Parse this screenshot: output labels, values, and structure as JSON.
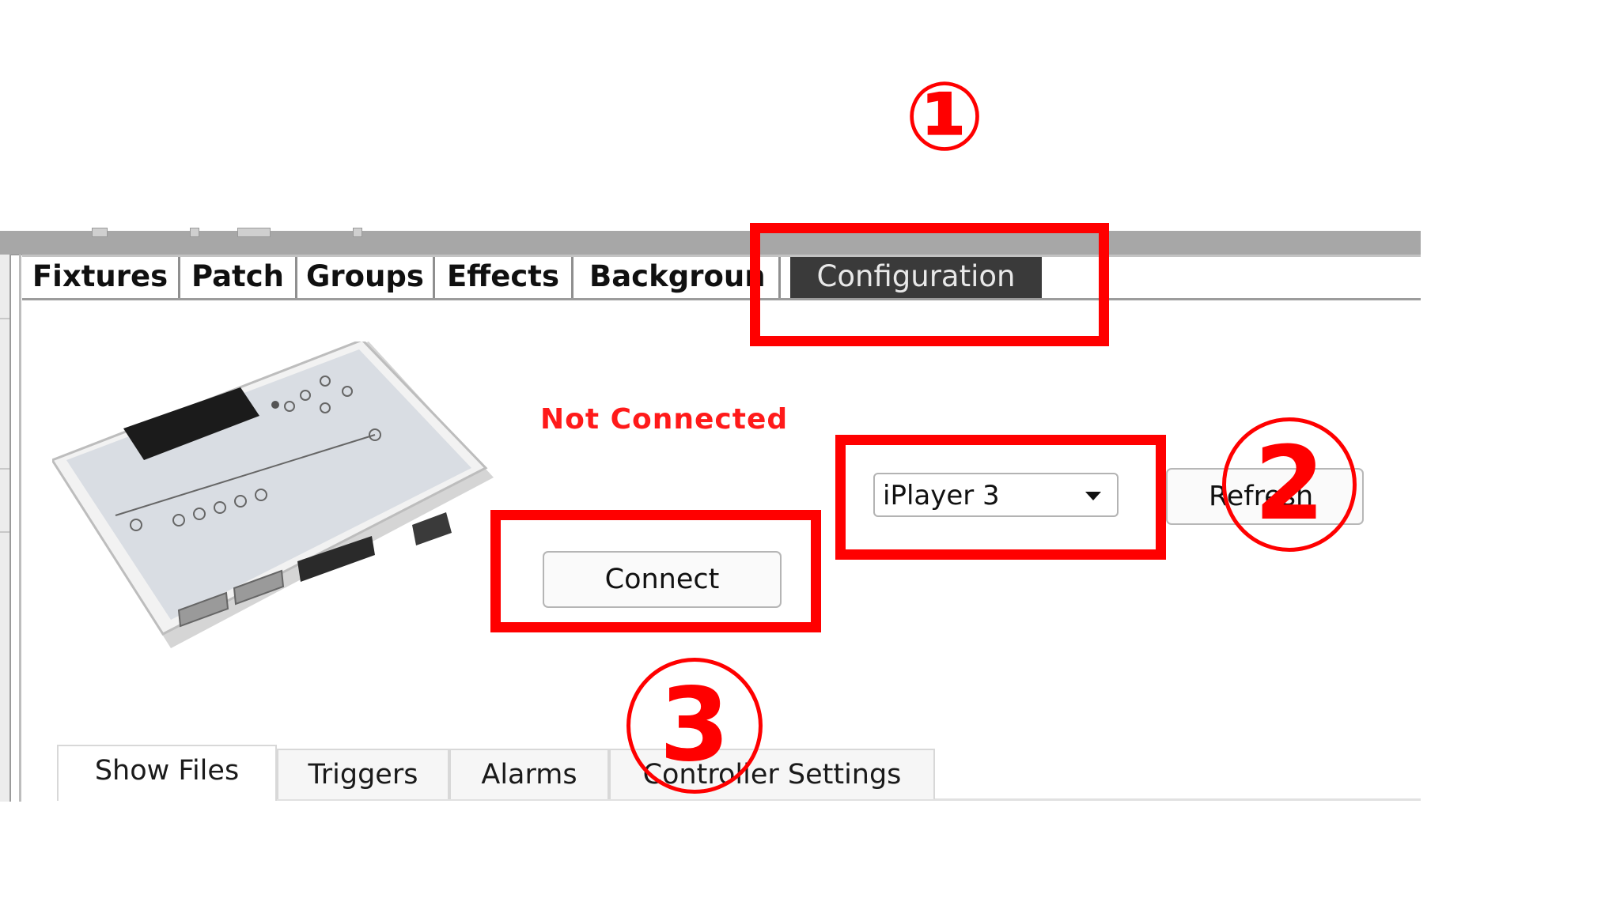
{
  "top_tabs": [
    {
      "label": "Fixtures"
    },
    {
      "label": "Patch"
    },
    {
      "label": "Groups"
    },
    {
      "label": "Effects"
    },
    {
      "label": "Backgroun"
    },
    {
      "label": "Configuration",
      "active": true
    }
  ],
  "device": {
    "status": "Not Connected"
  },
  "buttons": {
    "connect": "Connect",
    "refresh": "Refresh"
  },
  "player_select": {
    "selected": "iPlayer 3"
  },
  "bottom_tabs": [
    {
      "label": "Show Files",
      "active": true
    },
    {
      "label": "Triggers"
    },
    {
      "label": "Alarms"
    },
    {
      "label": "Controller Settings"
    }
  ],
  "annotations": {
    "step_1": "①",
    "step_2": "2",
    "step_3": "3",
    "color": "#ff0000"
  },
  "colors": {
    "active_tab": "#3a3a3a",
    "status_error": "#ff1a1a"
  }
}
